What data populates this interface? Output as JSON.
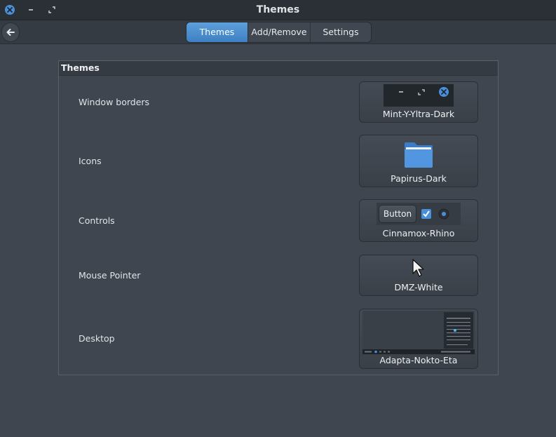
{
  "window": {
    "title": "Themes",
    "buttons": [
      "close-icon",
      "minimize-icon",
      "maximize-icon"
    ]
  },
  "toolbar": {
    "tabs": [
      {
        "label": "Themes",
        "active": true
      },
      {
        "label": "Add/Remove",
        "active": false
      },
      {
        "label": "Settings",
        "active": false
      }
    ]
  },
  "section": {
    "title": "Themes",
    "rows": [
      {
        "label": "Window borders",
        "value": "Mint-Y-Yltra-Dark",
        "preview_icon": "window-controls-icon"
      },
      {
        "label": "Icons",
        "value": "Papirus-Dark",
        "preview_icon": "folder-icon"
      },
      {
        "label": "Controls",
        "value": "Cinnamox-Rhino",
        "preview_button": "Button"
      },
      {
        "label": "Mouse Pointer",
        "value": "DMZ-White",
        "preview_icon": "cursor-icon"
      },
      {
        "label": "Desktop",
        "value": "Adapta-Nokto-Eta",
        "preview_icon": "desktop-thumbnail"
      }
    ]
  },
  "colors": {
    "accent": "#4a90d9",
    "background": "#3f4650",
    "titlebar": "#2b3036"
  }
}
